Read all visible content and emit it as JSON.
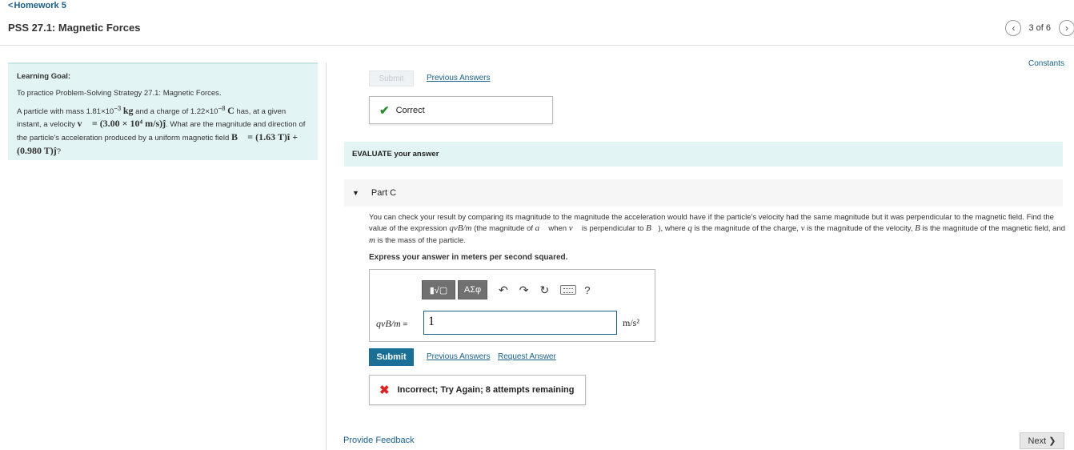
{
  "nav": {
    "back_chevron": "<",
    "back_label": "Homework 5",
    "title": "PSS 27.1: Magnetic Forces",
    "prev_glyph": "‹",
    "page_count": "3 of 6",
    "next_glyph": "›"
  },
  "goal": {
    "heading": "Learning Goal:",
    "line1": "To practice Problem-Solving Strategy 27.1: Magnetic Forces.",
    "p_start": "A particle with mass 1.81×10",
    "mass_exp": "−3",
    "mass_unit": "kg",
    "p_and": " and a charge of 1.22×10",
    "charge_exp": "−8",
    "charge_unit": "C",
    "p_has": " has, at a given instant, a velocity ",
    "velocity_expr": "v⃗ = (3.00 × 10⁴ m/s)ĵ",
    "p_question": ". What are the magnitude and direction of the particle's acceleration  produced by a uniform magnetic field ",
    "field_expr": "B⃗ = (1.63 T)î + (0.980 T)ĵ",
    "p_end": "?"
  },
  "constants_link": "Constants",
  "prior_part": {
    "submit_label": "Submit",
    "previous_answers": "Previous Answers",
    "correct_icon": "✔",
    "correct_text": "Correct"
  },
  "evaluate_heading": "EVALUATE your answer",
  "part_c": {
    "toggle_icon": "▼",
    "label": "Part C",
    "instr_1": "You can check your result by comparing its magnitude to the magnitude the acceleration would have if the particle's velocity had the same magnitude but it was perpendicular to the magnetic field. Find the value of the expression ",
    "instr_expr": "qvB/m",
    "instr_2": " (the magnitude of ",
    "instr_a": "a⃗",
    "instr_3": " when ",
    "instr_v": "v⃗",
    "instr_4": " is perpendicular to ",
    "instr_B": "B⃗",
    "instr_5": "), where ",
    "instr_q": "q",
    "instr_6": " is the magnitude of the charge, ",
    "instr_v2": "v",
    "instr_7": " is the magnitude of the velocity, ",
    "instr_B2": "B",
    "instr_8": " is the magnitude of the magnetic field, and ",
    "instr_m": "m",
    "instr_9": " is the mass of the particle.",
    "express": "Express your answer in meters per second squared.",
    "toolbar": {
      "templates_label": "▮√▢",
      "greek_label": "ΑΣφ",
      "undo_glyph": "↶",
      "redo_glyph": "↷",
      "reset_glyph": "↻",
      "help_glyph": "?"
    },
    "answer_label": "qvB/m",
    "answer_eq": " = ",
    "answer_value": "1",
    "answer_unit": "m/s²",
    "submit_label": "Submit",
    "previous_answers": "Previous Answers",
    "request_answer": "Request Answer",
    "incorrect_icon": "✖",
    "incorrect_text": "Incorrect; Try Again; 8 attempts remaining"
  },
  "footer": {
    "feedback": "Provide Feedback",
    "next_label": "Next",
    "next_glyph": "❯"
  },
  "colors": {
    "link": "#1a5f8a",
    "submit_bg": "#1a6f96",
    "band_bg": "#e3f4f4",
    "correct_green": "#2e8b2e",
    "incorrect_red": "#dd2222"
  }
}
